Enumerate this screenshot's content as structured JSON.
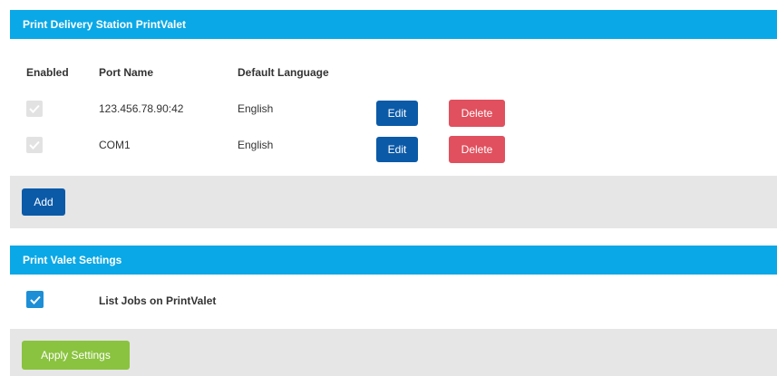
{
  "station_panel": {
    "title": "Print Delivery Station PrintValet",
    "columns": {
      "enabled": "Enabled",
      "port_name": "Port Name",
      "default_language": "Default Language"
    },
    "rows": [
      {
        "enabled": true,
        "port_name": "123.456.78.90:42",
        "language": "English",
        "edit_label": "Edit",
        "delete_label": "Delete"
      },
      {
        "enabled": true,
        "port_name": "COM1",
        "language": "English",
        "edit_label": "Edit",
        "delete_label": "Delete"
      }
    ],
    "add_label": "Add"
  },
  "settings_panel": {
    "title": "Print Valet Settings",
    "list_jobs_label": "List Jobs on PrintValet",
    "list_jobs_checked": true,
    "apply_label": "Apply Settings"
  },
  "colors": {
    "header_bg": "#0aa8e6",
    "primary_button": "#0b5aa8",
    "danger_button": "#e0505e",
    "success_button": "#8ac33f",
    "footer_bg": "#e6e6e6"
  },
  "icons": {
    "checkmark": "check-icon"
  }
}
